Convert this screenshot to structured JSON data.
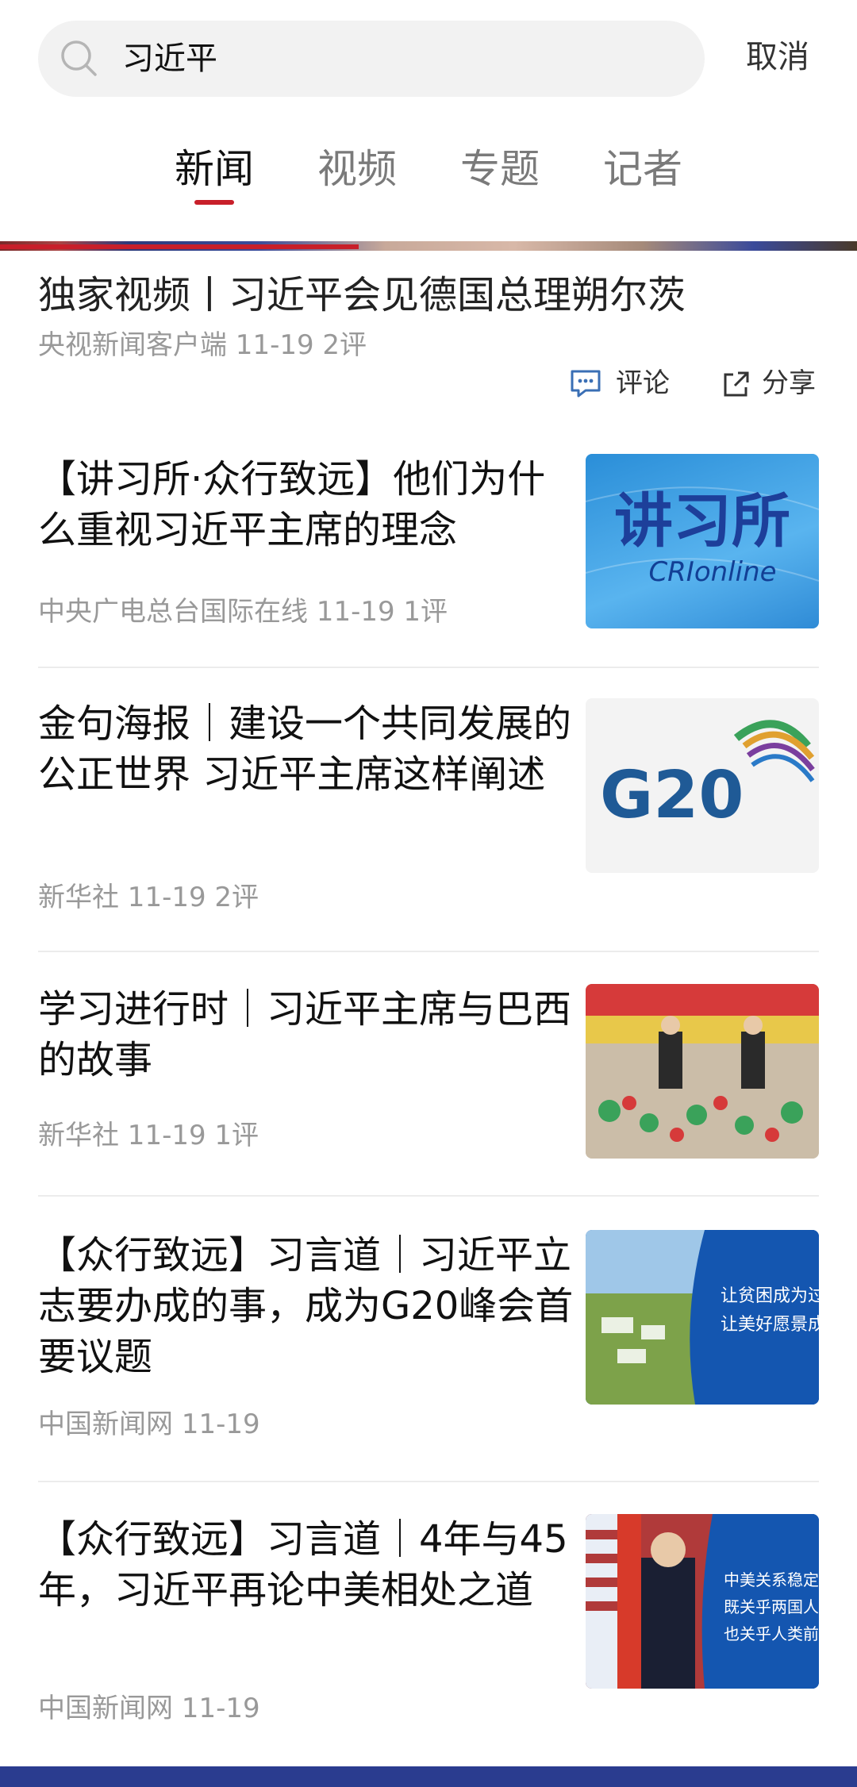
{
  "search": {
    "query": "习近平",
    "cancel_label": "取消"
  },
  "tabs": [
    {
      "label": "新闻"
    },
    {
      "label": "视频"
    },
    {
      "label": "专题"
    },
    {
      "label": "记者"
    }
  ],
  "featured": {
    "title": "独家视频丨习近平会见德国总理朔尔茨",
    "meta": "央视新闻客户端  11-19  2评",
    "comment_label": "评论",
    "share_label": "分享"
  },
  "news": [
    {
      "title": "【讲习所·众行致远】他们为什么重视习近平主席的理念",
      "meta": "中央广电总台国际在线  11-19  1评",
      "thumb_text_cn": "讲习所",
      "thumb_text_en": "CRIonline"
    },
    {
      "title": "金句海报｜建设一个共同发展的公正世界 习近平主席这样阐述",
      "meta": "新华社  11-19  2评",
      "thumb_text": "G20"
    },
    {
      "title": "学习进行时｜习近平主席与巴西的故事",
      "meta": "新华社  11-19  1评"
    },
    {
      "title": "【众行致远】习言道｜习近平立志要办成的事，成为G20峰会首要议题",
      "meta": "中国新闻网  11-19",
      "thumb_line1": "让贫困成为过去,",
      "thumb_line2": "让美好愿景成为"
    },
    {
      "title": "【众行致远】习言道｜4年与45年，习近平再论中美相处之道",
      "meta": "中国新闻网  11-19",
      "thumb_line1": "中美关系稳定发",
      "thumb_line2": "既关乎两国人民",
      "thumb_line3": "也关乎人类前途"
    }
  ],
  "colors": {
    "accent": "#c81f2a",
    "meta": "#999999",
    "bottom_bar": "#2a3c8f"
  }
}
